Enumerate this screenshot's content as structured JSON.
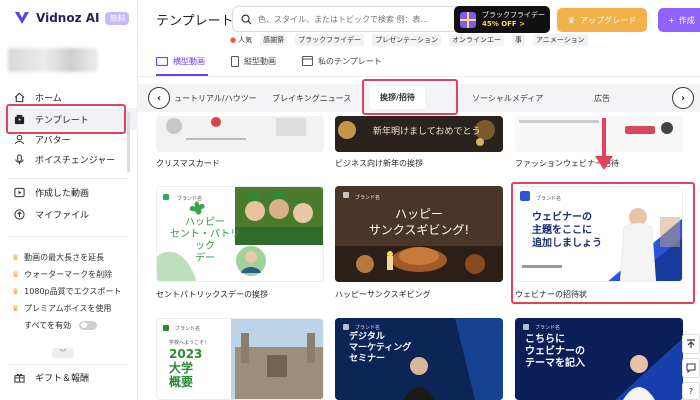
{
  "app": {
    "name": "Vidnoz AI",
    "badge": "無料"
  },
  "sidebar": {
    "items": [
      {
        "label": "ホーム",
        "icon": "home-icon"
      },
      {
        "label": "テンプレート",
        "icon": "template-icon"
      },
      {
        "label": "アバター",
        "icon": "avatar-icon"
      },
      {
        "label": "ボイスチェンジャー",
        "icon": "voice-changer-icon"
      },
      {
        "label": "作成した動画",
        "icon": "video-icon"
      },
      {
        "label": "マイファイル",
        "icon": "upload-icon"
      }
    ],
    "premium": [
      "動画の最大長さを延長",
      "ウォーターマークを削除",
      "1080p品質でエクスポート",
      "プレミアムボイスを使用"
    ],
    "all_enabled": "すべてを有効",
    "gift": "ギフト＆報酬"
  },
  "header": {
    "title": "テンプレート",
    "search_placeholder": "色、スタイル、またはトピックで検索 例：表...",
    "promo_line1": "ブラックフライデー",
    "promo_line2": "45% OFF >",
    "upgrade": "アップグレード",
    "create": "作成"
  },
  "tags": {
    "hot": "人気",
    "items": [
      "感謝祭",
      "ブラックフライデー",
      "プレゼンテーション",
      "オンラインエー",
      "事",
      "アニメーション"
    ]
  },
  "subtabs": [
    "横型動画",
    "縦型動画",
    "私のテンプレート"
  ],
  "categories": [
    "ュートリアル/ハウツー",
    "ブレイキングニュース",
    "挨拶/招待",
    "ソーシャルメディア",
    "広告"
  ],
  "cards": {
    "row1": [
      "クリスマスカード",
      "ビジネス向け新年の挨拶",
      "ファッションウェビナー招待"
    ],
    "row1_text": "新年明けましておめでとう",
    "row2": [
      "セントパトリックスデーの挨拶",
      "ハッピーサンクスギビング",
      "ウェビナーの招待状"
    ],
    "stpat": "ハッピー\nセント・パトリック\nデー",
    "thanks": "ハッピー\nサンクスギビング!",
    "webinar": "ウェビナーの\n主題をここに\n追加しましょう",
    "row3": {
      "univ": "2023\n大学\n概要",
      "univ_small": "学校へようこそ！",
      "marketing": "デジタル\nマーケティング\nセミナー",
      "webinar2": "こちらに\nウェビナーの\nテーマを記入"
    },
    "brand": "ブランド名"
  },
  "colors": {
    "accent": "#6f3fff",
    "highlight": "#e5405e",
    "upgrade": "#f3b14a"
  }
}
